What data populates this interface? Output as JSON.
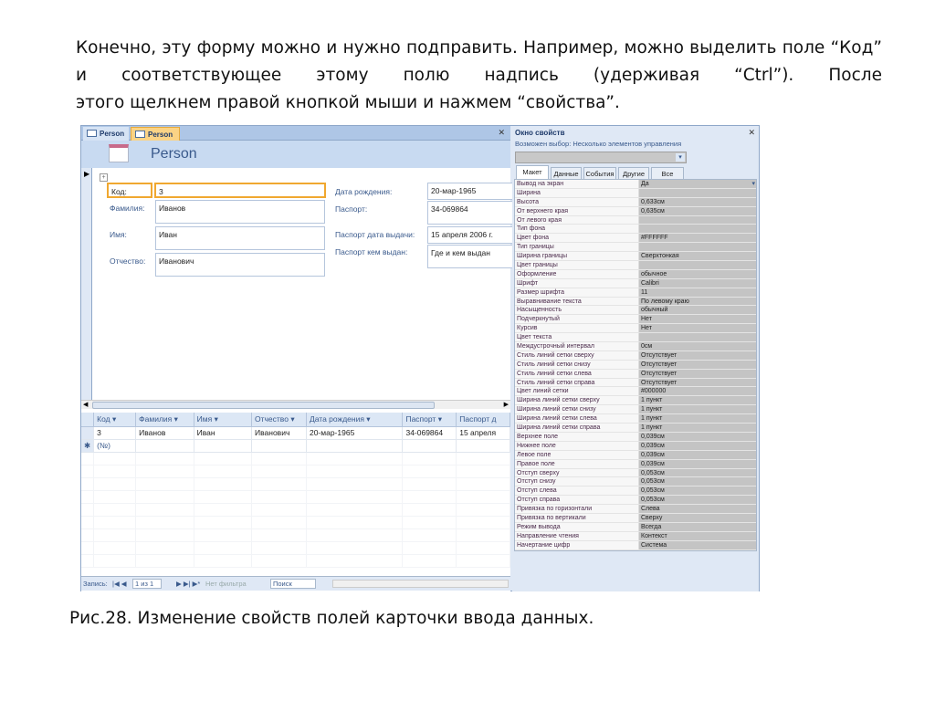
{
  "slide": {
    "paragraph_lines": [
      "Конечно, эту форму можно и нужно подправить. Например, можно выделить",
      "поле “Код” и соответствующее этому полю надпись (удерживая “Ctrl”). После",
      "этого щелкнем правой кнопкой мыши и нажмем “свойства”."
    ],
    "caption": "Рис.28. Изменение свойств полей карточки ввода данных."
  },
  "form": {
    "tabs": [
      "Person",
      "Person"
    ],
    "title": "Person",
    "fields": {
      "kod": {
        "label": "Код:",
        "value": "3"
      },
      "familia": {
        "label": "Фамилия:",
        "value": "Иванов"
      },
      "imya": {
        "label": "Имя:",
        "value": "Иван"
      },
      "otchestvo": {
        "label": "Отчество:",
        "value": "Иванович"
      },
      "dob": {
        "label": "Дата рождения:",
        "value": "20-мар-1965"
      },
      "passport": {
        "label": "Паспорт:",
        "value": "34-069864"
      },
      "pdate": {
        "label": "Паспорт дата выдачи:",
        "value": "15 апреля 2006 г."
      },
      "pby": {
        "label": "Паспорт кем выдан:",
        "value": "Где и кем выдан"
      }
    }
  },
  "datasheet": {
    "columns": [
      "Код",
      "Фамилия",
      "Имя",
      "Отчество",
      "Дата рождения",
      "Паспорт",
      "Паспорт д"
    ],
    "rows": [
      [
        "3",
        "Иванов",
        "Иван",
        "Иванович",
        "20-мар-1965",
        "34-069864",
        "15 апреля"
      ]
    ],
    "new_row": "(№)"
  },
  "nav": {
    "label": "Запись:",
    "position": "1 из 1",
    "filter": "Нет фильтра",
    "search": "Поиск"
  },
  "props": {
    "title": "Окно свойств",
    "subtitle": "Возможен выбор:  Несколько элементов управления",
    "tabs": [
      "Макет",
      "Данные",
      "События",
      "Другие",
      "Все"
    ],
    "rows": [
      [
        "Вывод на экран",
        "Да"
      ],
      [
        "Ширина",
        ""
      ],
      [
        "Высота",
        "0,633см"
      ],
      [
        "От верхнего края",
        "0,635см"
      ],
      [
        "От левого края",
        ""
      ],
      [
        "Тип фона",
        ""
      ],
      [
        "Цвет фона",
        "#FFFFFF"
      ],
      [
        "Тип границы",
        ""
      ],
      [
        "Ширина границы",
        "Сверхтонкая"
      ],
      [
        "Цвет границы",
        ""
      ],
      [
        "Оформление",
        "обычное"
      ],
      [
        "Шрифт",
        "Calibri"
      ],
      [
        "Размер шрифта",
        "11"
      ],
      [
        "Выравнивание текста",
        "По левому краю"
      ],
      [
        "Насыщенность",
        "обычный"
      ],
      [
        "Подчеркнутый",
        "Нет"
      ],
      [
        "Курсив",
        "Нет"
      ],
      [
        "Цвет текста",
        ""
      ],
      [
        "Междустрочный интервал",
        "0см"
      ],
      [
        "Стиль линий сетки сверху",
        "Отсутствует"
      ],
      [
        "Стиль линий сетки снизу",
        "Отсутствует"
      ],
      [
        "Стиль линий сетки слева",
        "Отсутствует"
      ],
      [
        "Стиль линий сетки справа",
        "Отсутствует"
      ],
      [
        "Цвет линий сетки",
        "#000000"
      ],
      [
        "Ширина линий сетки сверху",
        "1 пункт"
      ],
      [
        "Ширина линий сетки снизу",
        "1 пункт"
      ],
      [
        "Ширина линий сетки слева",
        "1 пункт"
      ],
      [
        "Ширина линий сетки справа",
        "1 пункт"
      ],
      [
        "Верхнее поле",
        "0,039см"
      ],
      [
        "Нижнее поле",
        "0,039см"
      ],
      [
        "Левое поле",
        "0,039см"
      ],
      [
        "Правое поле",
        "0,039см"
      ],
      [
        "Отступ сверху",
        "0,053см"
      ],
      [
        "Отступ снизу",
        "0,053см"
      ],
      [
        "Отступ слева",
        "0,053см"
      ],
      [
        "Отступ справа",
        "0,053см"
      ],
      [
        "Привязка по горизонтали",
        "Слева"
      ],
      [
        "Привязка по вертикали",
        "Сверху"
      ],
      [
        "Режим вывода",
        "Всегда"
      ],
      [
        "Направление чтения",
        "Контекст"
      ],
      [
        "Начертание цифр",
        "Система"
      ]
    ]
  }
}
